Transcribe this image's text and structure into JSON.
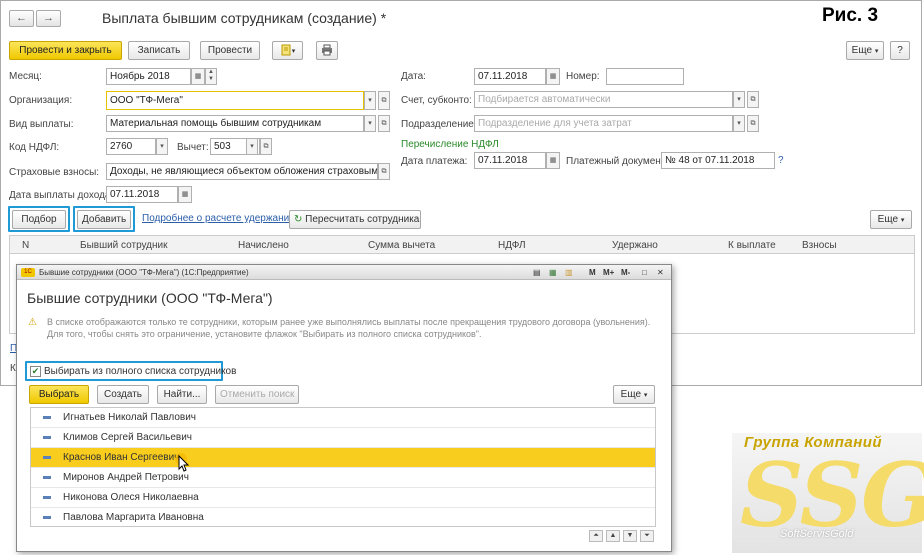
{
  "ris_label": "Рис. 3",
  "window": {
    "title": "Выплата бывшим сотрудникам (создание) *",
    "nav_back": "←",
    "nav_forward": "→"
  },
  "toolbar": {
    "post_close": "Провести и закрыть",
    "save": "Записать",
    "post": "Провести",
    "more": "Еще",
    "help": "?"
  },
  "form": {
    "month_label": "Месяц:",
    "month_value": "Ноябрь 2018",
    "org_label": "Организация:",
    "org_value": "ООО \"ТФ-Мега\"",
    "payment_type_label": "Вид выплаты:",
    "payment_type_value": "Материальная помощь бывшим сотрудникам",
    "ndfl_code_label": "Код НДФЛ:",
    "ndfl_code_value": "2760",
    "deduction_label": "Вычет:",
    "deduction_value": "503",
    "insurance_label": "Страховые взносы:",
    "insurance_value": "Доходы, не являющиеся объектом обложения страховыми взно",
    "income_date_label": "Дата выплаты дохода:",
    "income_date_value": "07.11.2018",
    "date_label": "Дата:",
    "date_value": "07.11.2018",
    "number_label": "Номер:",
    "number_value": "",
    "account_label": "Счет, субконто:",
    "account_placeholder": "Подбирается автоматически",
    "division_label": "Подразделение:",
    "division_placeholder": "Подразделение для учета затрат",
    "ndfl_transfer": "Перечисление НДФЛ",
    "pay_date_label": "Дата платежа:",
    "pay_date_value": "07.11.2018",
    "pay_doc_label": "Платежный документ:",
    "pay_doc_value": "№ 48 от 07.11.2018",
    "pay_doc_help": "?"
  },
  "table_toolbar": {
    "select": "Подбор",
    "add": "Добавить",
    "details_link": "Подробнее о расчете удержаний",
    "recalc": "Пересчитать сотрудника",
    "more": "Еще"
  },
  "table": {
    "columns": [
      "N",
      "Бывший сотрудник",
      "Начислено",
      "Сумма вычета",
      "НДФЛ",
      "Удержано",
      "К выплате",
      "Взносы"
    ]
  },
  "peek": {
    "p_link": "П",
    "k_label": "К"
  },
  "dialog": {
    "window_title": "Бывшие сотрудники (ООО \"ТФ-Мега\") (1С:Предприятие)",
    "heading": "Бывшие сотрудники (ООО \"ТФ-Мега\")",
    "warning_line1": "В списке отображаются только те сотрудники, которым ранее уже выполнялись выплаты после прекращения трудового договора (увольнения).",
    "warning_line2": "Для того, чтобы снять это ограничение, установите флажок \"Выбирать из полного списка сотрудников\".",
    "checkbox_label": "Выбирать из полного списка сотрудников",
    "checkbox_checked": true,
    "btn_select": "Выбрать",
    "btn_create": "Создать",
    "btn_find": "Найти...",
    "btn_cancel_search": "Отменить поиск",
    "btn_more": "Еще",
    "employees": [
      "Игнатьев Николай Павлович",
      "Климов Сергей Васильевич",
      "Краснов Иван Сергеевич",
      "Миронов Андрей Петрович",
      "Никонова Олеся Николаевна",
      "Павлова Маргарита Ивановна"
    ],
    "selected_index": 2,
    "tb_m": "M",
    "tb_mplus": "M+",
    "tb_mminus": "M-"
  },
  "watermark": {
    "top": "Группа Компаний",
    "big": "SSG",
    "sub": "SoftServisGold"
  },
  "colors": {
    "accent_blue": "#1e9ad6",
    "yellow_button": "#f0c800",
    "selection": "#f9cd1e",
    "link": "#2b5ea8",
    "green": "#2a8a2a"
  }
}
